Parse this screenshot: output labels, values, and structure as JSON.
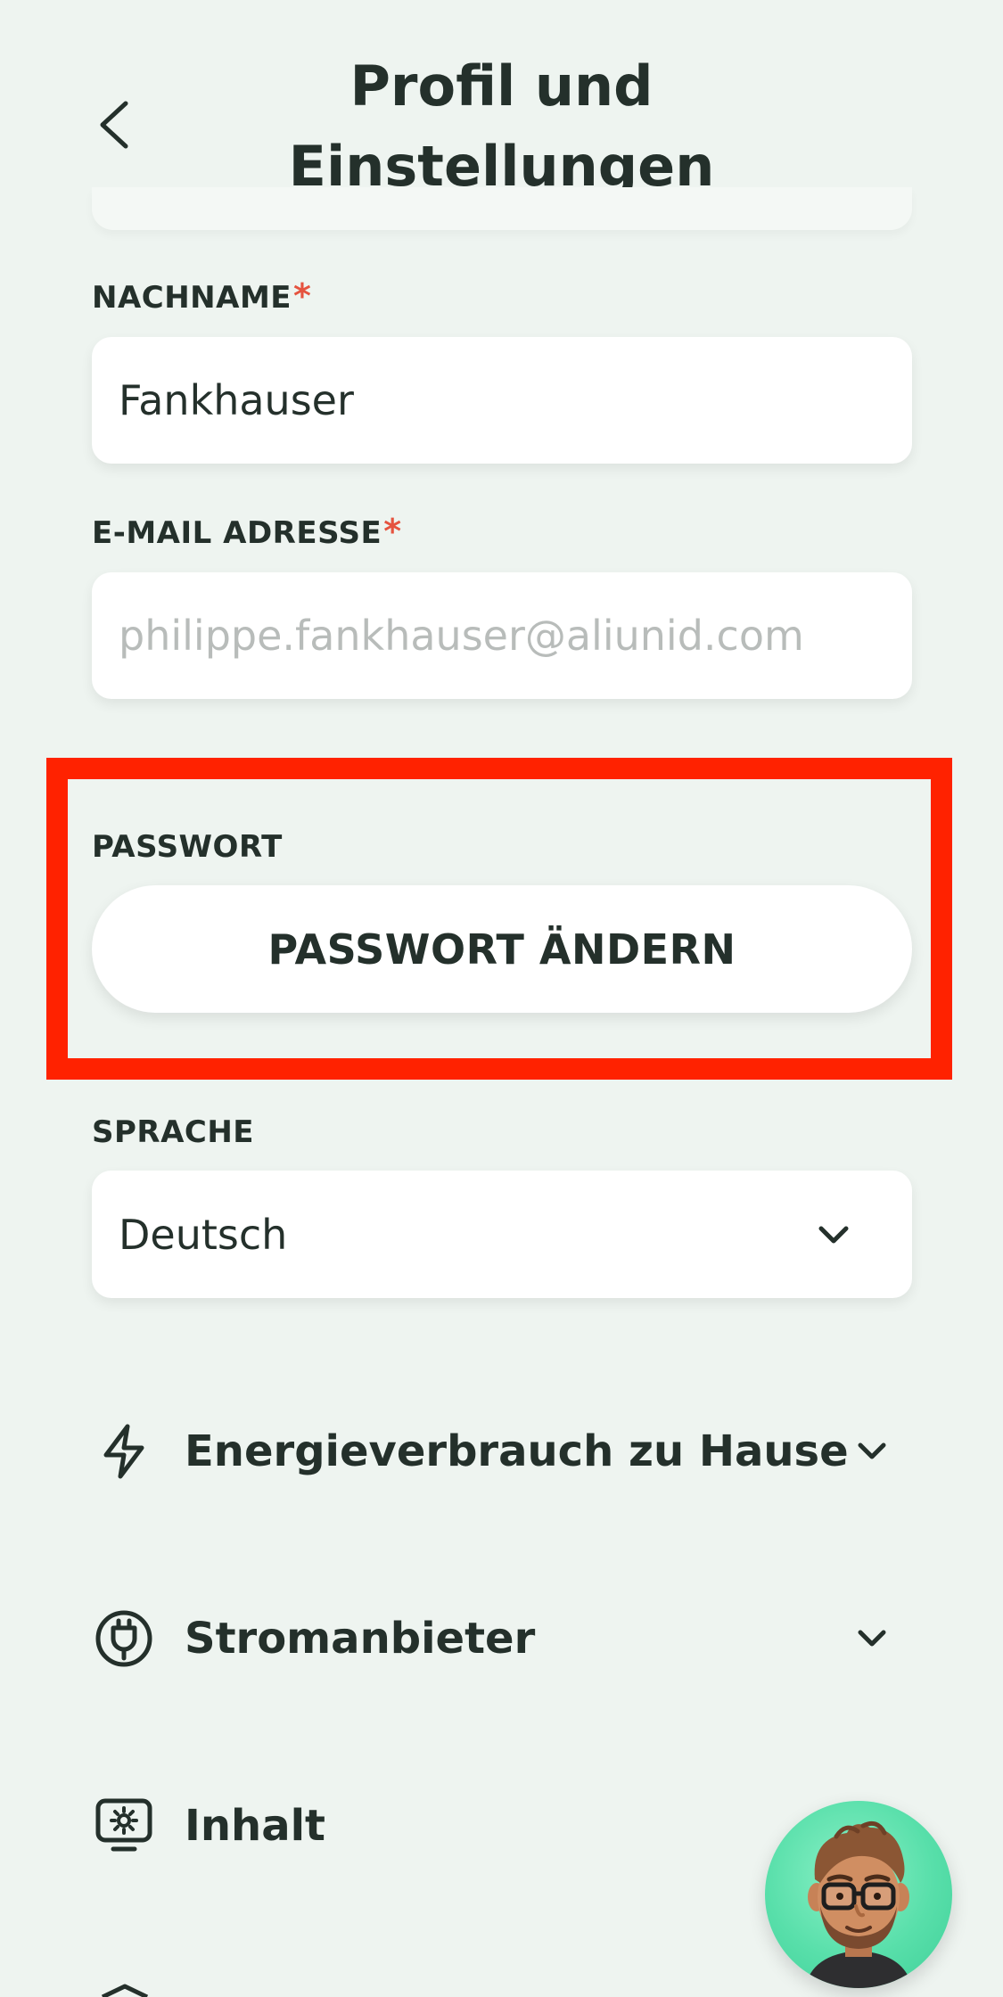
{
  "header": {
    "title_line1": "Profil und",
    "title_line2": "Einstellungen",
    "back_icon": "chevron-left-icon"
  },
  "form": {
    "lastname": {
      "label": "NACHNAME",
      "required_mark": "*",
      "value": "Fankhauser"
    },
    "email": {
      "label": "E-MAIL ADRESSE",
      "required_mark": "*",
      "placeholder": "philippe.fankhauser@aliunid.com"
    },
    "password": {
      "label": "PASSWORT",
      "button_label": "PASSWORT ÄNDERN"
    },
    "language": {
      "label": "SPRACHE",
      "selected": "Deutsch"
    }
  },
  "sections": [
    {
      "label": "Energieverbrauch zu Hause",
      "icon": "lightning-icon",
      "expandable": true
    },
    {
      "label": "Stromanbieter",
      "icon": "plug-icon",
      "expandable": true
    },
    {
      "label": "Inhalt",
      "icon": "monitor-settings-icon",
      "expandable": false
    }
  ],
  "colors": {
    "background": "#eef4f0",
    "text": "#24302b",
    "required": "#e5533f",
    "highlight_box": "#ff2200",
    "avatar_bg": "#58dfaa"
  }
}
